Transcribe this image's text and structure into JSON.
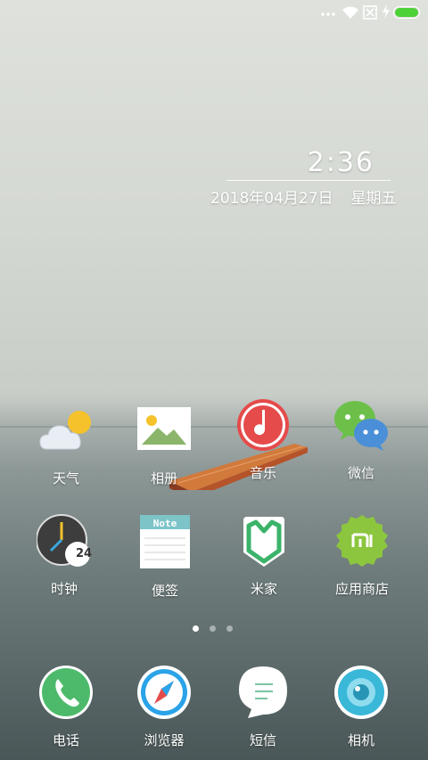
{
  "clock": {
    "time": "2:36",
    "date": "2018年04月27日",
    "weekday": "星期五"
  },
  "status_bar": {
    "icons": [
      "signal-dots-icon",
      "wifi-icon",
      "no-sim-icon",
      "charging-icon",
      "battery-icon"
    ],
    "battery_level": 1.0,
    "battery_color": "#4cd137"
  },
  "apps_row1": [
    {
      "label": "天气",
      "icon": "weather-icon"
    },
    {
      "label": "相册",
      "icon": "gallery-icon"
    },
    {
      "label": "音乐",
      "icon": "music-icon"
    },
    {
      "label": "微信",
      "icon": "wechat-icon"
    }
  ],
  "apps_row2": [
    {
      "label": "时钟",
      "icon": "clock-icon",
      "badge": "24"
    },
    {
      "label": "便签",
      "icon": "notes-icon",
      "badge": "Note"
    },
    {
      "label": "米家",
      "icon": "mijia-icon"
    },
    {
      "label": "应用商店",
      "icon": "app-store-icon"
    }
  ],
  "dock": [
    {
      "label": "电话",
      "icon": "phone-icon"
    },
    {
      "label": "浏览器",
      "icon": "browser-icon"
    },
    {
      "label": "短信",
      "icon": "messages-icon"
    },
    {
      "label": "相机",
      "icon": "camera-icon"
    }
  ],
  "page_indicator": {
    "pages": 3,
    "current": 1
  },
  "colors": {
    "phone": "#4cba6a",
    "browser": "#2aa3e8",
    "camera": "#39b8d8",
    "music": "#e54b4b",
    "wechat_green": "#6cc04a",
    "wechat_blue": "#4a8fd8",
    "mijia": "#3bb36a",
    "app_store": "#8cc63f",
    "clock_bg": "#3d3d3d"
  }
}
